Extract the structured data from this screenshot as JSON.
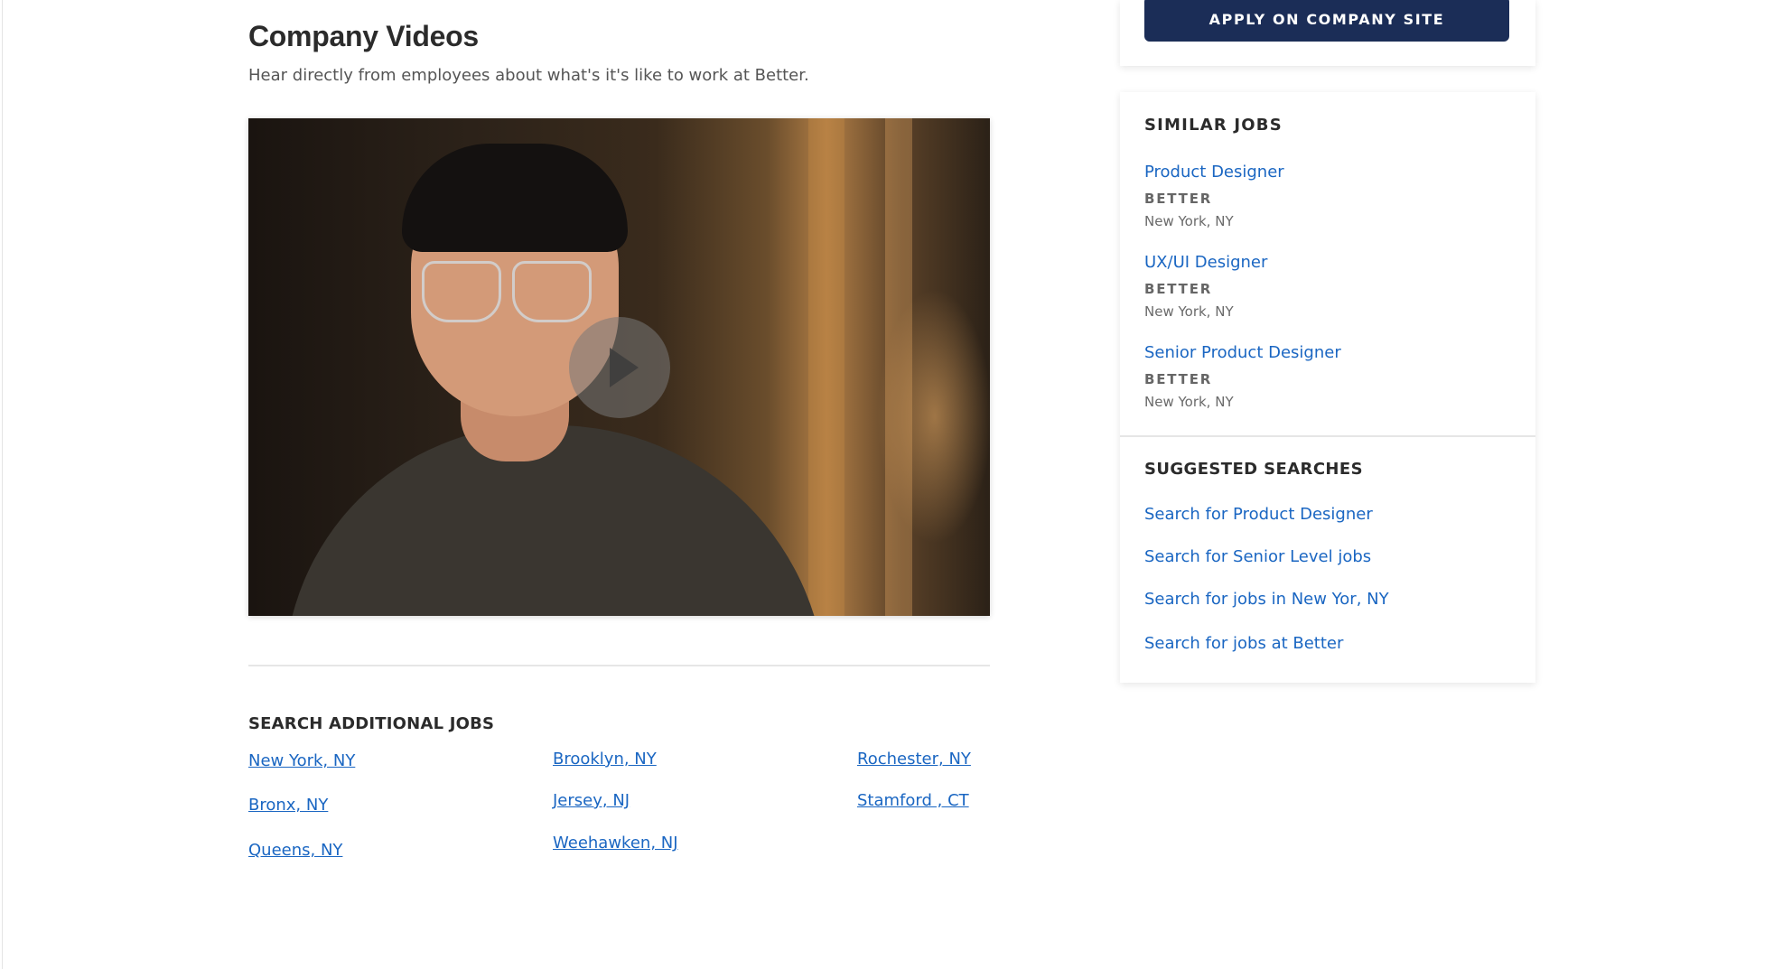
{
  "company_videos": {
    "title": "Company Videos",
    "subtitle": "Hear directly from employees about what's it's like to work at Better.",
    "video": {
      "play_icon": "play-icon"
    }
  },
  "additional_jobs": {
    "title": "SEARCH ADDITIONAL JOBS",
    "locations": [
      "New York, NY",
      "Brooklyn, NY",
      "Rochester, NY",
      "Bronx, NY",
      "Jersey, NJ",
      "Stamford , CT",
      "Queens, NY",
      "Weehawken, NJ"
    ]
  },
  "sidebar": {
    "apply_label": "APPLY ON COMPANY SITE",
    "similar_jobs_title": "SIMILAR JOBS",
    "similar_jobs": [
      {
        "title": "Product Designer",
        "company": "BETTER",
        "location": "New York, NY"
      },
      {
        "title": "UX/UI Designer",
        "company": "BETTER",
        "location": "New York, NY"
      },
      {
        "title": "Senior Product Designer",
        "company": "BETTER",
        "location": "New York, NY"
      }
    ],
    "suggested_title": "SUGGESTED SEARCHES",
    "suggested_searches": [
      "Search for Product Designer",
      "Search for Senior Level jobs",
      "Search for jobs in New Yor, NY",
      "Search for jobs at Better"
    ]
  },
  "colors": {
    "link": "#1a66c2",
    "apply_button": "#1b2d57",
    "heading": "#2b2b2b"
  }
}
